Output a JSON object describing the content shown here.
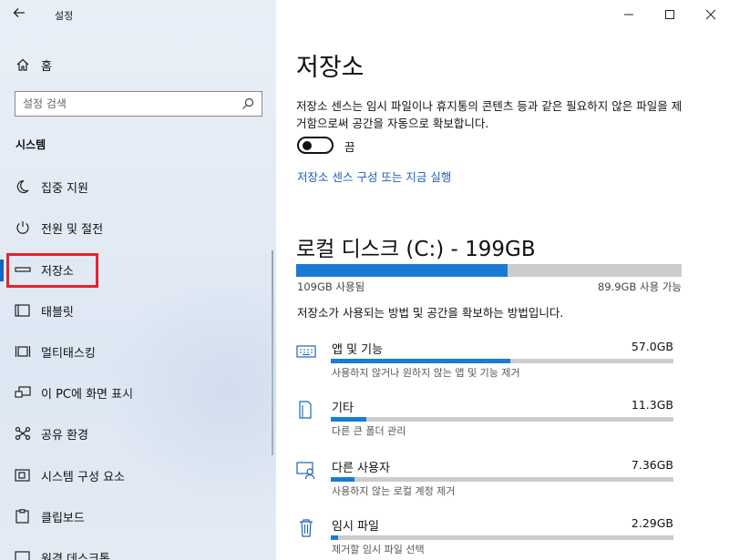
{
  "window": {
    "title": "설정"
  },
  "sidebar": {
    "home_label": "홈",
    "search_placeholder": "설정 검색",
    "section_title": "시스템",
    "items": [
      {
        "label": "집중 지원",
        "icon": "moon-icon"
      },
      {
        "label": "전원 및 절전",
        "icon": "power-icon"
      },
      {
        "label": "저장소",
        "icon": "storage-icon",
        "selected": true
      },
      {
        "label": "태블릿",
        "icon": "tablet-icon"
      },
      {
        "label": "멀티태스킹",
        "icon": "multitasking-icon"
      },
      {
        "label": "이 PC에 화면 표시",
        "icon": "project-icon"
      },
      {
        "label": "공유 환경",
        "icon": "shared-icon"
      },
      {
        "label": "시스템 구성 요소",
        "icon": "components-icon"
      },
      {
        "label": "클립보드",
        "icon": "clipboard-icon"
      },
      {
        "label": "원격 데스크톱",
        "icon": "remote-icon"
      }
    ]
  },
  "main": {
    "title": "저장소",
    "description": "저장소 센스는 임시 파일이나 휴지통의 콘텐츠 등과 같은 필요하지 않은 파일을 제거함으로써 공간을 자동으로 확보합니다.",
    "toggle_state": "끔",
    "toggle_on": false,
    "configure_link": "저장소 센스 구성 또는 지금 실행",
    "disk": {
      "title": "로컬 디스크 (C:) - 199GB",
      "used_label": "109GB 사용됨",
      "free_label": "89.9GB 사용 가능",
      "used_fraction": 0.548
    },
    "how_to": "저장소가 사용되는 방법 및 공간을 확보하는 방법입니다.",
    "categories": [
      {
        "name": "앱 및 기능",
        "size": "57.0GB",
        "sub": "사용하지 않거나 원하지 않는 앱 및 기능 제거",
        "fraction": 0.523,
        "icon": "keyboard-icon"
      },
      {
        "name": "기타",
        "size": "11.3GB",
        "sub": "다른 큰 폴더 관리",
        "fraction": 0.104,
        "icon": "folder-icon"
      },
      {
        "name": "다른 사용자",
        "size": "7.36GB",
        "sub": "사용하지 않는 로컬 계정 제거",
        "fraction": 0.068,
        "icon": "users-icon"
      },
      {
        "name": "임시 파일",
        "size": "2.29GB",
        "sub": "제거할 임시 파일 선택",
        "fraction": 0.021,
        "icon": "trash-icon"
      }
    ]
  },
  "colors": {
    "accent": "#1a7bd4",
    "link": "#1f5fb0",
    "highlight_box": "#e8212b",
    "bar_bg": "#cccccc"
  }
}
